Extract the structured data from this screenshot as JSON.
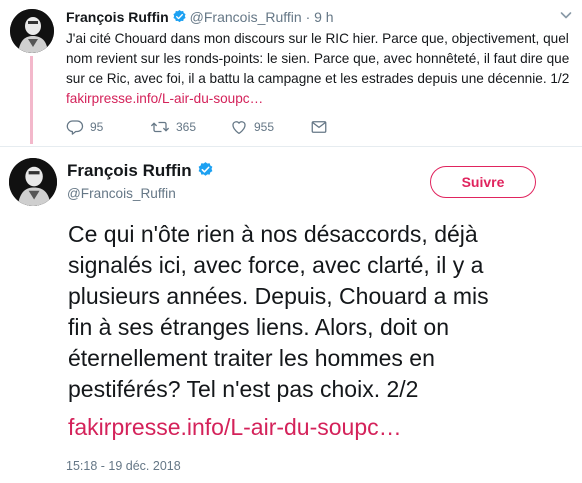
{
  "tweet1": {
    "author_name": "François Ruffin",
    "handle": "@Francois_Ruffin",
    "separator": "·",
    "time": "9 h",
    "text": "J'ai cité Chouard dans mon discours sur le RIC hier. Parce que, objectivement, quel nom revient sur les ronds-points: le sien. Parce que, avec honnêteté, il faut dire que sur ce Ric, avec foi, il a battu la campagne et les estrades depuis une décennie. 1/2 ",
    "link": "fakirpresse.info/L-air-du-soupc…",
    "actions": {
      "replies": "95",
      "retweets": "365",
      "likes": "955"
    }
  },
  "tweet2": {
    "author_name": "François Ruffin",
    "handle": "@Francois_Ruffin",
    "follow_label": "Suivre",
    "text": "Ce qui n'ôte rien à nos désaccords, déjà\nsignalés ici, avec force, avec clarté, il y a\nplusieurs années.  Depuis, Chouard a mis\nfin à ses étranges liens. Alors, doit on\néternellement traiter les hommes en\npestiférés? Tel n'est pas choix. 2/2",
    "link": "fakirpresse.info/L-air-du-soupc…",
    "date": "15:18 - 19 déc. 2018"
  },
  "colors": {
    "accent": "#e0245e",
    "link": "#d4225a",
    "muted": "#657786",
    "verified": "#1da1f2",
    "thread_line": "#f3b8cb"
  },
  "icons": [
    "verified-badge-icon",
    "chevron-down-icon",
    "reply-icon",
    "retweet-icon",
    "like-icon",
    "message-icon"
  ]
}
